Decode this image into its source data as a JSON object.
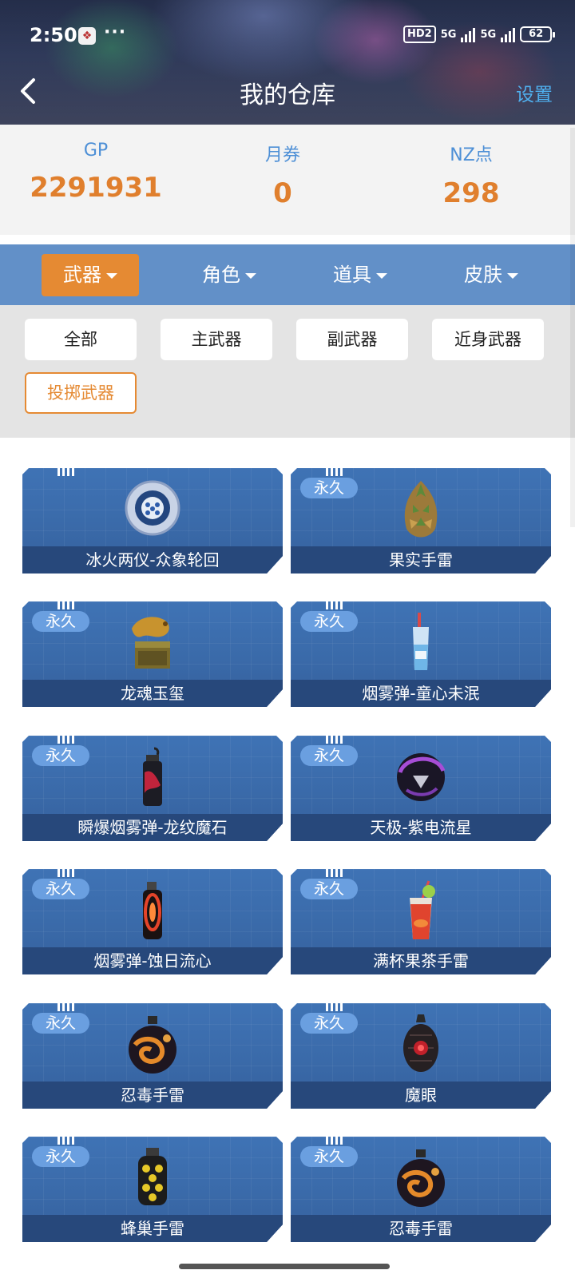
{
  "status_bar": {
    "time": "2:50",
    "dots": "···",
    "hd": "HD2",
    "net1": "5G",
    "net2": "5G",
    "battery": "62"
  },
  "header": {
    "title": "我的仓库",
    "settings_label": "设置",
    "back_icon": "chevron-left-icon"
  },
  "stats": [
    {
      "label": "GP",
      "value": "2291931"
    },
    {
      "label": "月券",
      "value": "0"
    },
    {
      "label": "NZ点",
      "value": "298"
    }
  ],
  "categories": [
    {
      "label": "武器",
      "active": true
    },
    {
      "label": "角色",
      "active": false
    },
    {
      "label": "道具",
      "active": false
    },
    {
      "label": "皮肤",
      "active": false
    }
  ],
  "filters": [
    {
      "label": "全部",
      "active": false
    },
    {
      "label": "主武器",
      "active": false
    },
    {
      "label": "副武器",
      "active": false
    },
    {
      "label": "近身武器",
      "active": false
    },
    {
      "label": "投掷武器",
      "active": true
    }
  ],
  "items": [
    {
      "name": "冰火两仪-众象轮回",
      "badge": "",
      "icon": "orb-grenade-icon"
    },
    {
      "name": "果实手雷",
      "badge": "永久",
      "icon": "fruit-grenade-icon"
    },
    {
      "name": "龙魂玉玺",
      "badge": "永久",
      "icon": "dragon-seal-icon"
    },
    {
      "name": "烟雾弹-童心未泯",
      "badge": "永久",
      "icon": "drink-bottle-icon"
    },
    {
      "name": "瞬爆烟雾弹-龙纹魔石",
      "badge": "永久",
      "icon": "smoke-canister-icon"
    },
    {
      "name": "天极-紫电流星",
      "badge": "永久",
      "icon": "purple-helmet-orb-icon"
    },
    {
      "name": "烟雾弹-蚀日流心",
      "badge": "永久",
      "icon": "eclipse-canister-icon"
    },
    {
      "name": "满杯果茶手雷",
      "badge": "永久",
      "icon": "fruit-tea-cup-icon"
    },
    {
      "name": "忍毒手雷",
      "badge": "永久",
      "icon": "poison-grenade-icon"
    },
    {
      "name": "魔眼",
      "badge": "永久",
      "icon": "demon-eye-grenade-icon"
    },
    {
      "name": "蜂巢手雷",
      "badge": "永久",
      "icon": "honeycomb-grenade-icon"
    },
    {
      "name": "忍毒手雷",
      "badge": "永久",
      "icon": "poison-grenade-icon"
    }
  ],
  "colors": {
    "accent_orange": "#e58a33",
    "stat_label_blue": "#4d8fd6",
    "stat_value_orange": "#e07f2d",
    "category_bar": "#6290c8",
    "card_blue": "#3a6aa9",
    "card_name_bar": "#27487b",
    "badge_blue": "#6a9fe0"
  }
}
